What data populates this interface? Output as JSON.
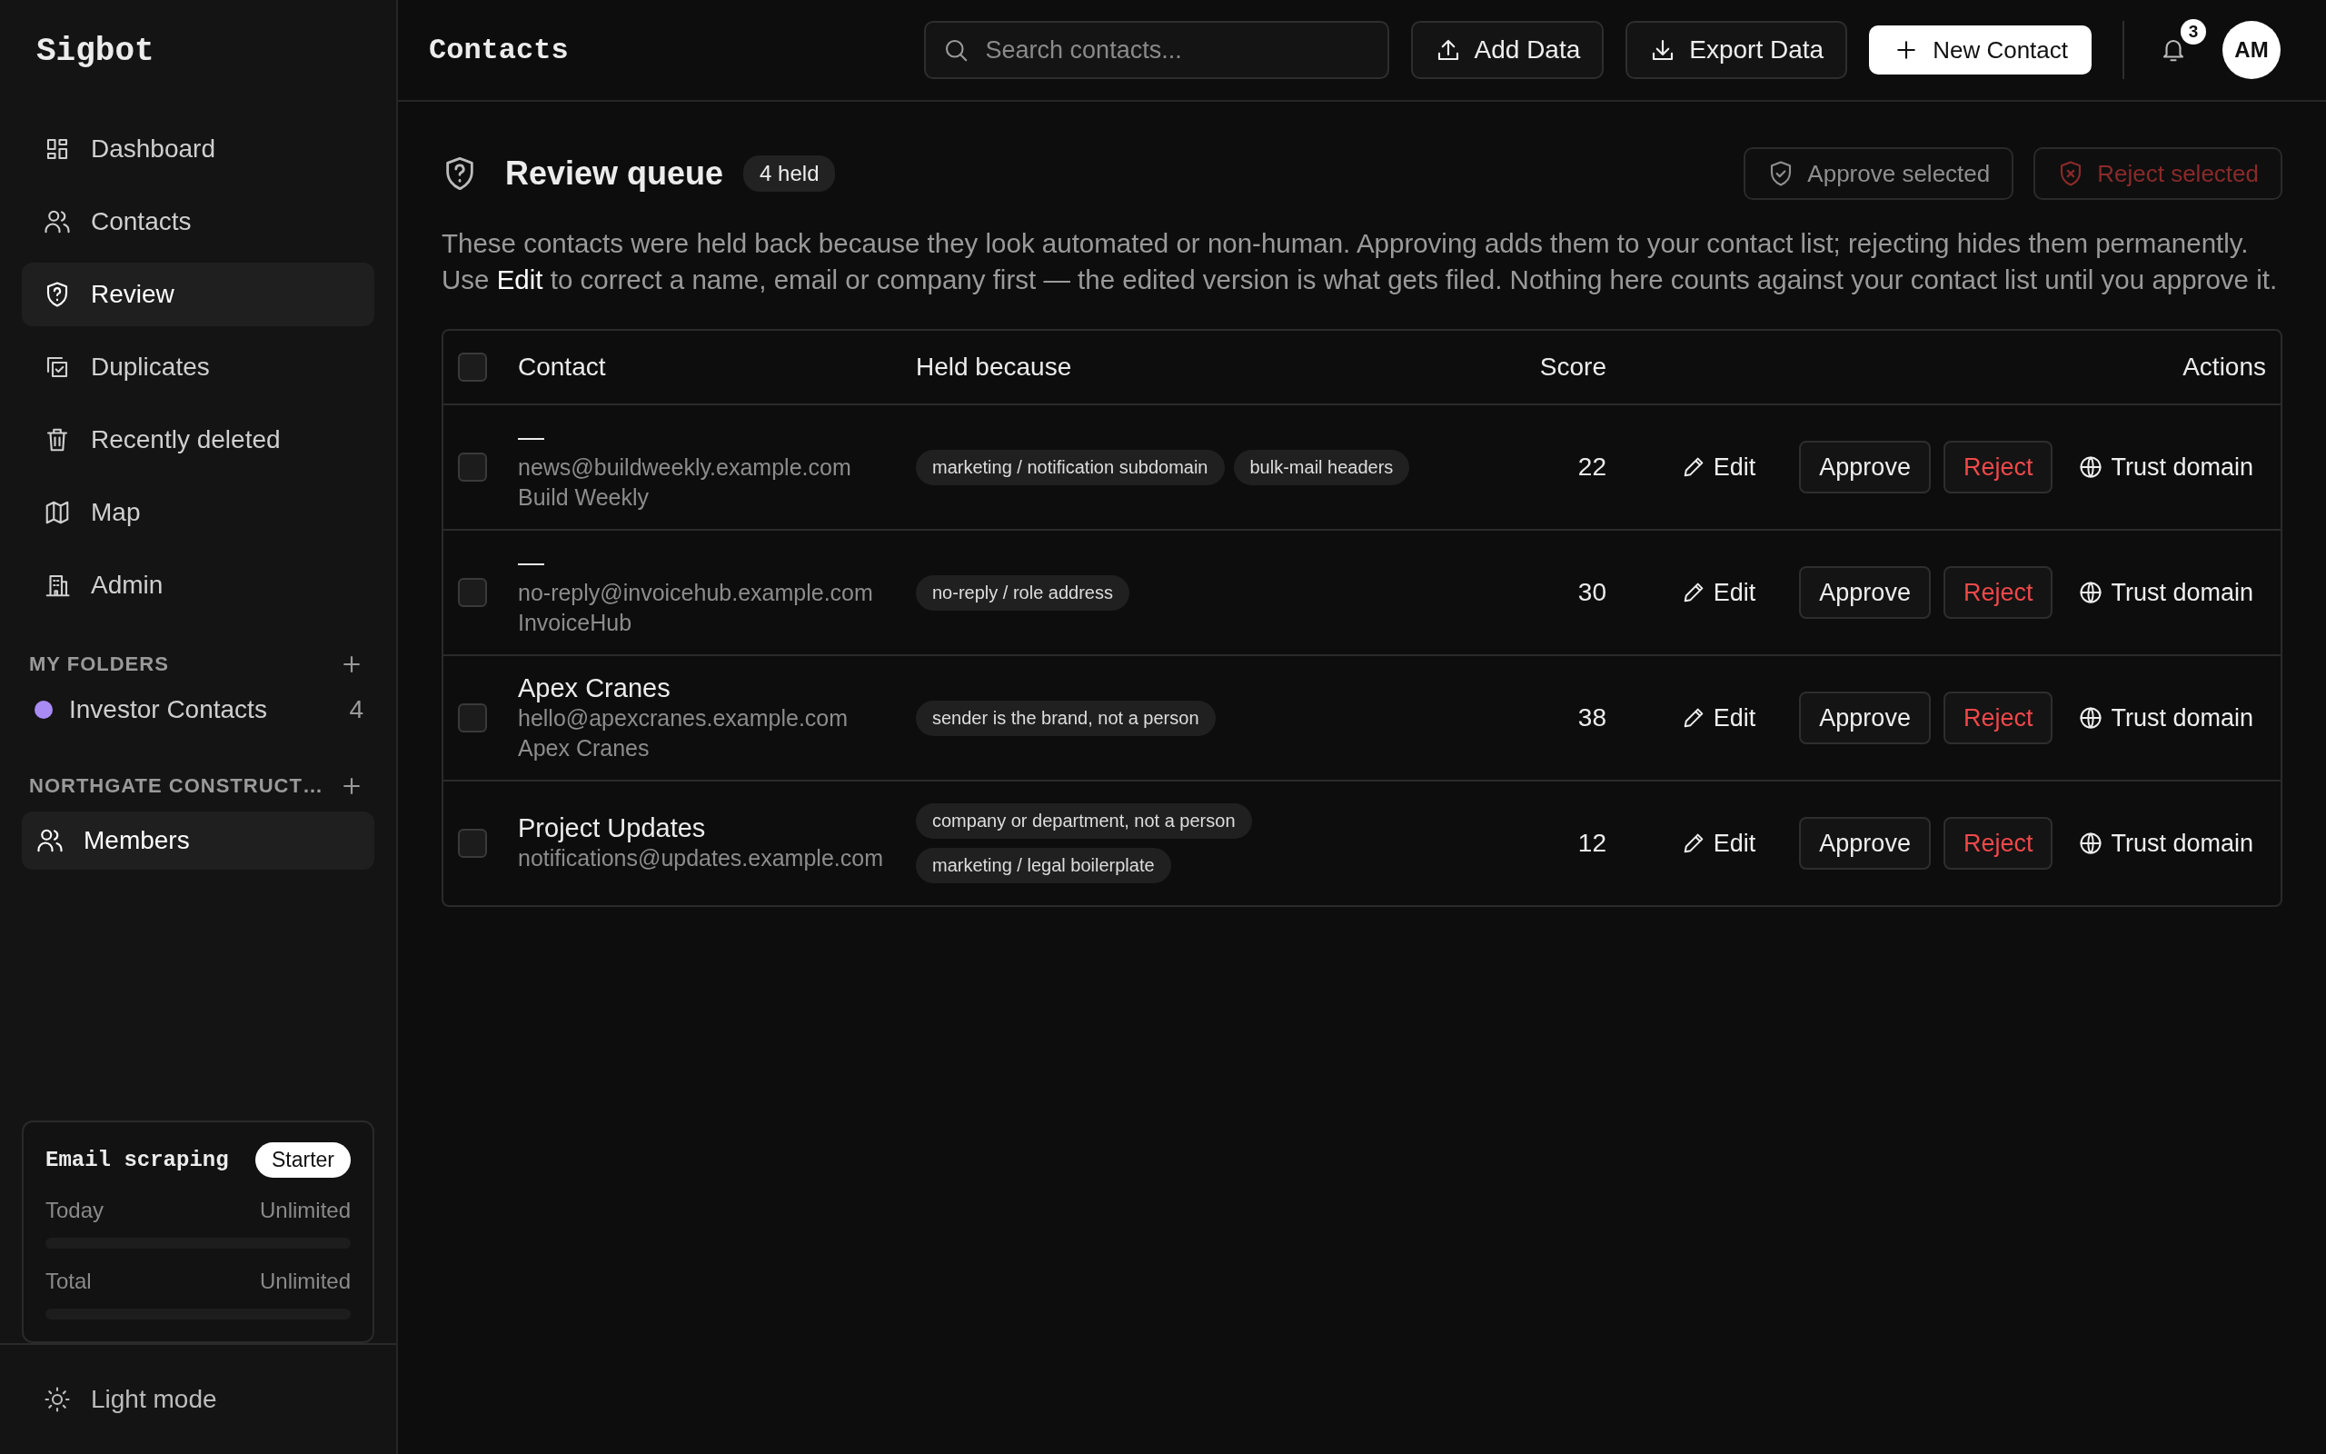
{
  "app": {
    "logo": "Sigbot"
  },
  "sidebar": {
    "items": [
      {
        "label": "Dashboard",
        "selected": false
      },
      {
        "label": "Contacts",
        "selected": false
      },
      {
        "label": "Review",
        "selected": true
      },
      {
        "label": "Duplicates",
        "selected": false
      },
      {
        "label": "Recently deleted",
        "selected": false
      },
      {
        "label": "Map",
        "selected": false
      },
      {
        "label": "Admin",
        "selected": false
      }
    ],
    "folders_heading": "MY FOLDERS",
    "folders": [
      {
        "label": "Investor Contacts",
        "count": "4",
        "color": "#a98bf5"
      }
    ],
    "org_heading": "NORTHGATE CONSTRUCT…",
    "org_items": [
      {
        "label": "Members",
        "selected": true
      }
    ],
    "usage": {
      "title": "Email scraping",
      "plan": "Starter",
      "meters": [
        {
          "label": "Today",
          "value": "Unlimited",
          "level": 0
        },
        {
          "label": "Total",
          "value": "Unlimited",
          "level": 0
        }
      ]
    },
    "theme_toggle": "Light mode"
  },
  "header": {
    "title": "Contacts",
    "search": {
      "placeholder": "Search contacts..."
    },
    "buttons": [
      "Add Data",
      "Export Data"
    ],
    "primary_button": "New Contact",
    "notifications": "3",
    "avatar": "AM"
  },
  "review": {
    "title": "Review queue",
    "badge": "4 held",
    "approve_selected": "Approve selected",
    "reject_selected": "Reject selected",
    "description": "These contacts were held back because they look automated or non-human. Approving adds them to your contact list; rejecting hides them permanently. Use **Edit** to correct a name, email or company first — the edited version is what gets filed. Nothing here counts against your contact list until you approve it."
  },
  "table": {
    "select_all": {
      "checked": false
    },
    "columns": [
      "Contact",
      "Held because",
      "Score",
      "Actions"
    ],
    "rows": [
      {
        "checked": false,
        "name": "—",
        "email": "news@buildweekly.example.com",
        "company": "Build Weekly",
        "reasons": [
          "marketing / notification subdomain",
          "bulk-mail headers"
        ],
        "score": "22",
        "actions": [
          "Edit",
          "Approve",
          "Reject",
          "Trust domain"
        ]
      },
      {
        "checked": false,
        "name": "—",
        "email": "no-reply@invoicehub.example.com",
        "company": "InvoiceHub",
        "reasons": [
          "no-reply / role address"
        ],
        "score": "30",
        "actions": [
          "Edit",
          "Approve",
          "Reject",
          "Trust domain"
        ]
      },
      {
        "checked": false,
        "name": "Apex Cranes",
        "email": "hello@apexcranes.example.com",
        "company": "Apex Cranes",
        "reasons": [
          "sender is the brand, not a person"
        ],
        "score": "38",
        "actions": [
          "Edit",
          "Approve",
          "Reject",
          "Trust domain"
        ]
      },
      {
        "checked": false,
        "name": "Project Updates",
        "email": "notifications@updates.example.com",
        "reasons": [
          "company or department, not a person",
          "marketing / legal boilerplate"
        ],
        "score": "12",
        "actions": [
          "Edit",
          "Approve",
          "Reject",
          "Trust domain"
        ]
      }
    ]
  }
}
